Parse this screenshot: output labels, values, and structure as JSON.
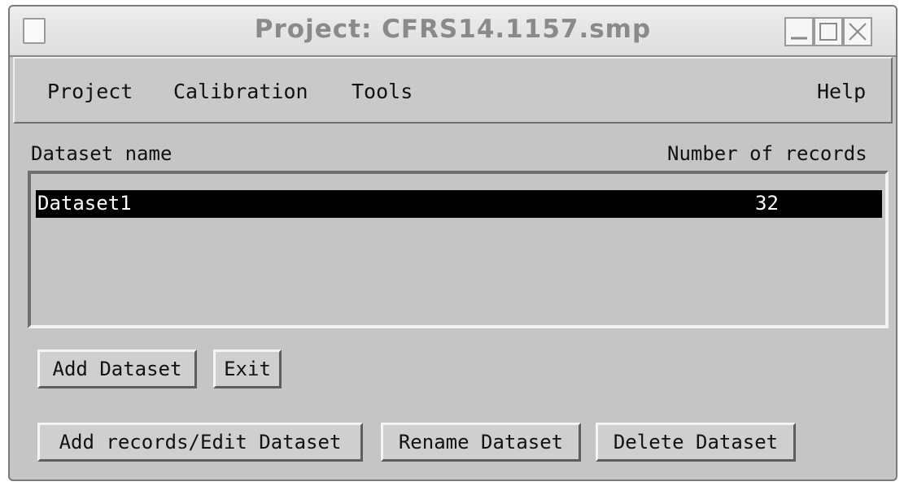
{
  "window": {
    "title": "Project: CFRS14.1157.smp"
  },
  "menu": {
    "project": "Project",
    "calibration": "Calibration",
    "tools": "Tools",
    "help": "Help"
  },
  "list": {
    "col_name": "Dataset name",
    "col_count": "Number of records",
    "rows": [
      {
        "name": "Dataset1",
        "count": "32",
        "selected": true
      }
    ]
  },
  "buttons": {
    "add_dataset": "Add Dataset",
    "exit": "Exit",
    "edit_dataset": "Add records/Edit Dataset",
    "rename_dataset": "Rename Dataset",
    "delete_dataset": "Delete Dataset"
  },
  "icons": {
    "window_menu": "window-menu-icon",
    "minimize": "minimize-icon",
    "maximize": "maximize-icon",
    "close": "close-icon"
  }
}
